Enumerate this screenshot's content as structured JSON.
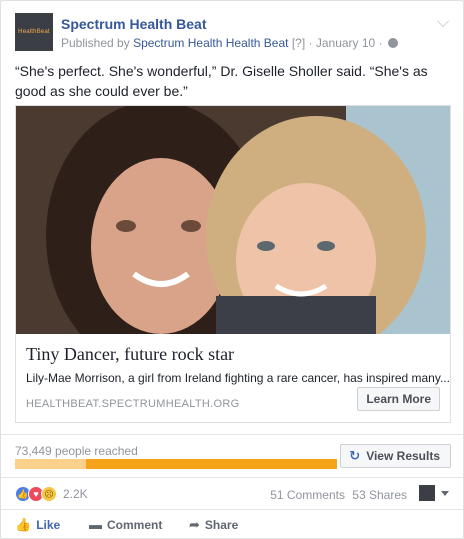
{
  "post": {
    "page_logo_text": "HealthBeat",
    "page_name": "Spectrum Health Beat",
    "published_by_prefix": "Published by",
    "published_by": "Spectrum Health Health Beat",
    "help_marker": "[?]",
    "date": "January 10",
    "text": "“She's perfect. She's wonderful,” Dr. Giselle Sholler said. “She's as good as she could ever be.”"
  },
  "link_preview": {
    "title": "Tiny Dancer, future rock star",
    "description": "Lily-Mae Morrison, a girl from Ireland fighting a rare cancer, has inspired many...",
    "domain": "HEALTHBEAT.SPECTRUMHEALTH.ORG",
    "cta_label": "Learn More"
  },
  "reach": {
    "label": "73,449 people reached",
    "organic_fraction": 0.22,
    "view_results_label": "View Results"
  },
  "engagement": {
    "reactions_count": "2.2K",
    "reaction_icons": [
      "like-icon",
      "love-icon",
      "sad-icon"
    ],
    "comments": "51 Comments",
    "shares": "53 Shares"
  },
  "actions": {
    "like": "Like",
    "comment": "Comment",
    "share": "Share"
  },
  "colors": {
    "link": "#365899",
    "reach_paid": "#f7a21b",
    "reach_organic": "#fbd08a"
  }
}
